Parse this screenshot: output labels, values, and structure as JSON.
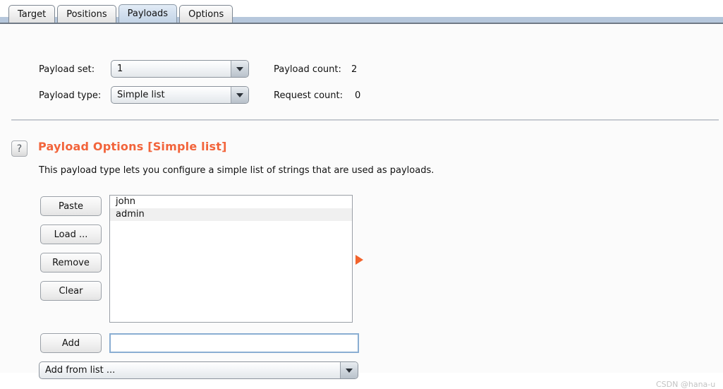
{
  "tabs": [
    {
      "label": "Target",
      "selected": false
    },
    {
      "label": "Positions",
      "selected": false
    },
    {
      "label": "Payloads",
      "selected": true
    },
    {
      "label": "Options",
      "selected": false
    }
  ],
  "settings": {
    "payload_set_label": "Payload set:",
    "payload_set_value": "1",
    "payload_type_label": "Payload type:",
    "payload_type_value": "Simple list",
    "payload_count_label": "Payload count:",
    "payload_count_value": "2",
    "request_count_label": "Request count:",
    "request_count_value": "0"
  },
  "section": {
    "help_icon": "question-mark-icon",
    "help_glyph": "?",
    "heading": "Payload Options [Simple list]",
    "heading_color": "#f2643b",
    "description": "This payload type lets you configure a simple list of strings that are used as payloads."
  },
  "buttons": {
    "paste": "Paste",
    "load": "Load ...",
    "remove": "Remove",
    "clear": "Clear",
    "add": "Add"
  },
  "payload_list": {
    "items": [
      "john",
      "admin"
    ]
  },
  "add_row": {
    "input_value": "",
    "input_placeholder": ""
  },
  "add_from_list": {
    "value": "Add from list ...",
    "arrow_icon": "chevron-down-icon"
  },
  "watermark": "CSDN @hana-u"
}
